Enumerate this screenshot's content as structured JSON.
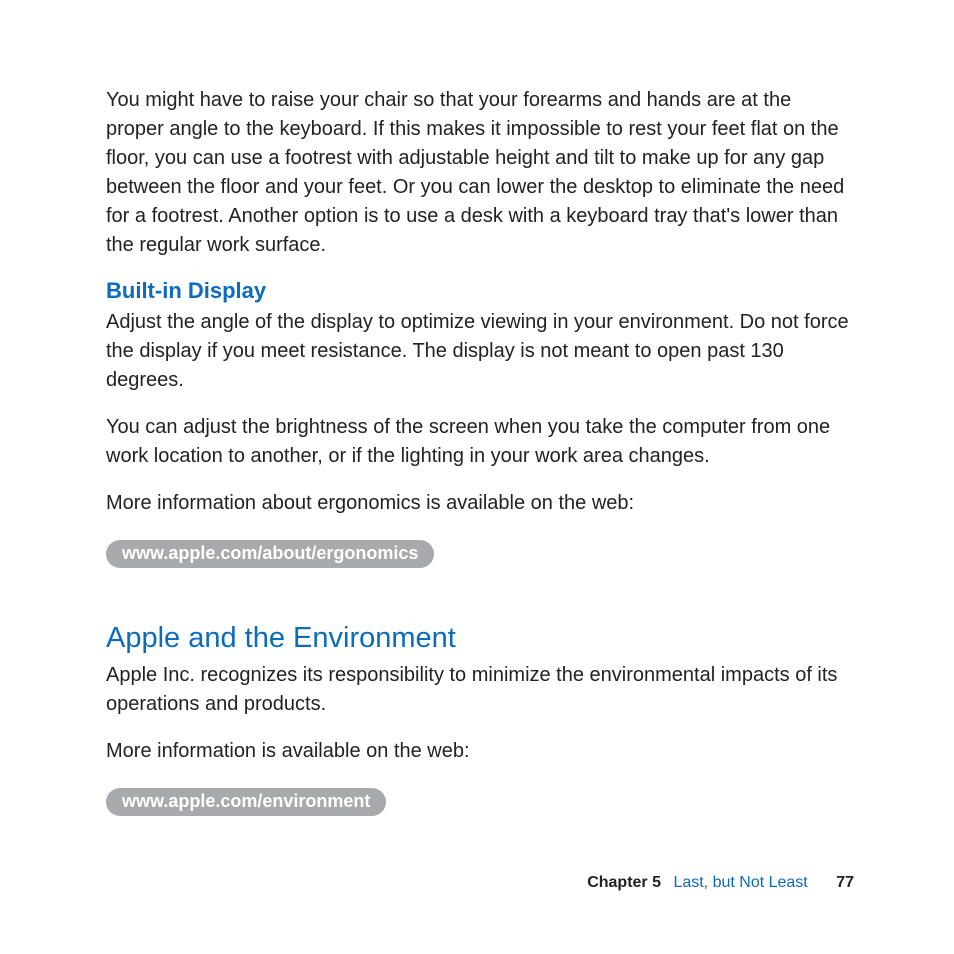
{
  "paragraphs": {
    "intro": "You might have to raise your chair so that your forearms and hands are at the proper angle to the keyboard. If this makes it impossible to rest your feet flat on the floor, you can use a footrest with adjustable height and tilt to make up for any gap between the floor and your feet. Or you can lower the desktop to eliminate the need for a footrest. Another option is to use a desk with a keyboard tray that's lower than the regular work surface."
  },
  "builtin_display": {
    "heading": "Built-in Display",
    "p1": "Adjust the angle of the display to optimize viewing in your environment. Do not force the display if you meet resistance. The display is not meant to open past 130 degrees.",
    "p2": "You can adjust the brightness of the screen when you take the computer from one work location to another, or if the lighting in your work area changes.",
    "p3": "More information about ergonomics is available on the web:",
    "link": "www.apple.com/about/ergonomics"
  },
  "environment": {
    "heading": "Apple and the Environment",
    "p1": "Apple Inc. recognizes its responsibility to minimize the environmental impacts of its operations and products.",
    "p2": "More information is available on the web:",
    "link": "www.apple.com/environment"
  },
  "footer": {
    "chapter_label": "Chapter 5",
    "chapter_title": "Last, but Not Least",
    "page_number": "77"
  }
}
